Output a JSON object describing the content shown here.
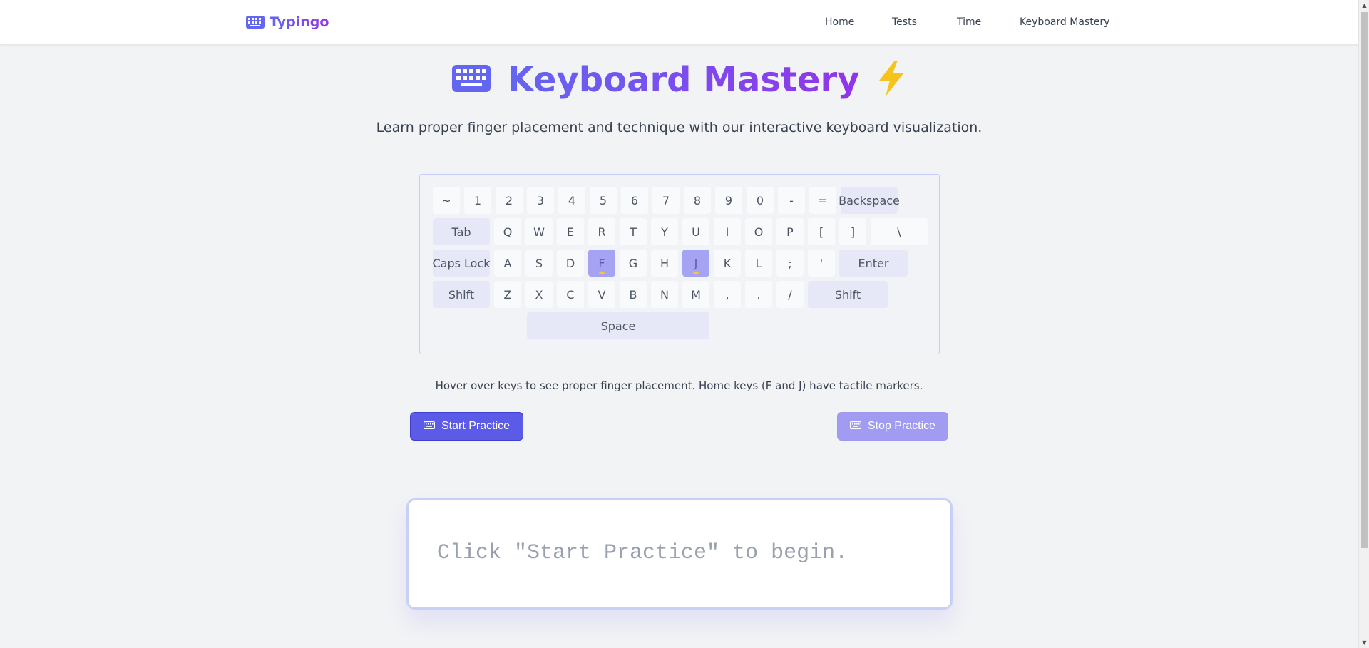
{
  "navbar": {
    "brand": "Typingo",
    "brand_icon": "keyboard-icon",
    "links": [
      {
        "label": "Home"
      },
      {
        "label": "Tests"
      },
      {
        "label": "Time"
      },
      {
        "label": "Keyboard Mastery"
      }
    ]
  },
  "hero": {
    "title": "Keyboard Mastery",
    "title_icon": "keyboard-icon",
    "title_emoji": "⚡",
    "subtitle": "Learn proper finger placement and technique with our interactive keyboard visualization."
  },
  "keyboard": {
    "rows": [
      [
        "~",
        "1",
        "2",
        "3",
        "4",
        "5",
        "6",
        "7",
        "8",
        "9",
        "0",
        "-",
        "=",
        "Backspace"
      ],
      [
        "Tab",
        "Q",
        "W",
        "E",
        "R",
        "T",
        "Y",
        "U",
        "I",
        "O",
        "P",
        "[",
        "]",
        "\\"
      ],
      [
        "Caps Lock",
        "A",
        "S",
        "D",
        "F",
        "G",
        "H",
        "J",
        "K",
        "L",
        ";",
        "'",
        "Enter"
      ],
      [
        "Shift",
        "Z",
        "X",
        "C",
        "V",
        "B",
        "N",
        "M",
        ",",
        ".",
        "/",
        "Shift"
      ],
      [
        "Space"
      ]
    ],
    "home_keys": [
      "F",
      "J"
    ]
  },
  "hint": "Hover over keys to see proper finger placement. Home keys (F and J) have tactile markers.",
  "buttons": {
    "start": "Start Practice",
    "stop": "Stop Practice"
  },
  "practice": {
    "prompt": "Click \"Start Practice\" to begin."
  },
  "colors": {
    "accent": "#6366f1",
    "accent_purple": "#9333ea",
    "home_key": "#a5a3f2",
    "marker": "#f6c343"
  }
}
